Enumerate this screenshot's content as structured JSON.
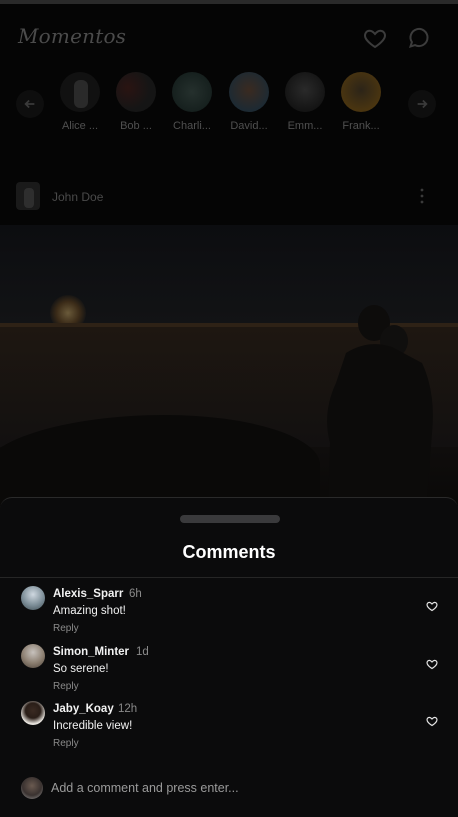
{
  "app": {
    "logo": "Momentos"
  },
  "header": {
    "icons": [
      "heart-icon",
      "chat-icon"
    ]
  },
  "stories": {
    "items": [
      {
        "label": "Alice ..."
      },
      {
        "label": "Bob ..."
      },
      {
        "label": "Charli..."
      },
      {
        "label": "David..."
      },
      {
        "label": "Emm..."
      },
      {
        "label": "Frank..."
      }
    ]
  },
  "post": {
    "username": "John Doe"
  },
  "comments_sheet": {
    "title": "Comments",
    "comments": [
      {
        "username": "Alexis_Sparr",
        "time": "6h",
        "text": "Amazing shot!",
        "reply": "Reply"
      },
      {
        "username": "Simon_Minter",
        "time": "1d",
        "text": "So serene!",
        "reply": "Reply"
      },
      {
        "username": "Jaby_Koay",
        "time": "12h",
        "text": "Incredible view!",
        "reply": "Reply"
      }
    ],
    "input": {
      "placeholder": "Add a comment and press enter..."
    }
  },
  "colors": {
    "sheet_bg": "#0b0b0c",
    "text": "#ffffff",
    "muted": "#8a8a8a"
  }
}
